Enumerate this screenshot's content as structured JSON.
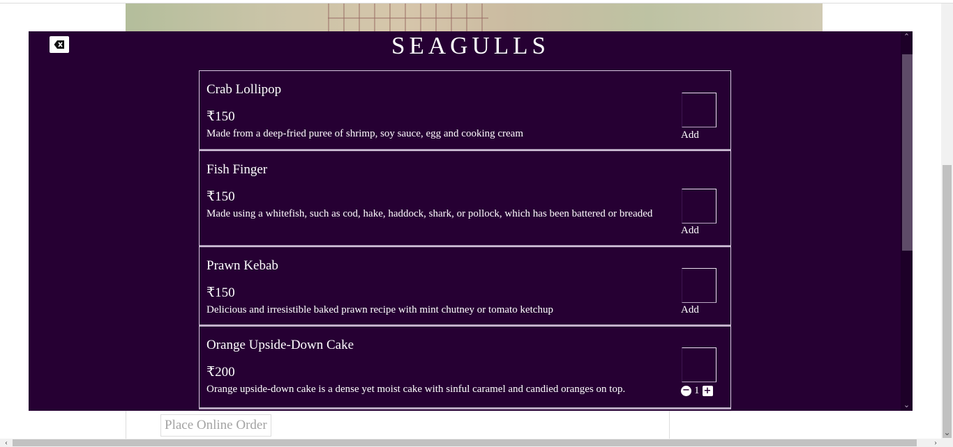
{
  "background": {
    "place_order_label": "Place Online Order"
  },
  "modal": {
    "title": "SEAGULLS",
    "close_icon": "backspace-close-icon"
  },
  "menu_items": [
    {
      "name": "Crab Lollipop",
      "price": "₹150",
      "description": "Made from a deep-fried puree of shrimp, soy sauce, egg and cooking cream",
      "action_label": "Add"
    },
    {
      "name": "Fish Finger",
      "price": "₹150",
      "description": "Made using a whitefish, such as cod, hake, haddock, shark, or pollock, which has been battered or breaded",
      "action_label": "Add"
    },
    {
      "name": "Prawn Kebab",
      "price": "₹150",
      "description": "Delicious and irresistible baked prawn recipe with mint chutney or tomato ketchup",
      "action_label": "Add"
    },
    {
      "name": "Orange Upside-Down Cake",
      "price": "₹200",
      "description": "Orange upside-down cake is a dense yet moist cake with sinful caramel and candied oranges on top.",
      "quantity": "1"
    }
  ],
  "colors": {
    "modal_bg": "#260033",
    "text": "#ffffff",
    "border": "#d8c9e0"
  }
}
